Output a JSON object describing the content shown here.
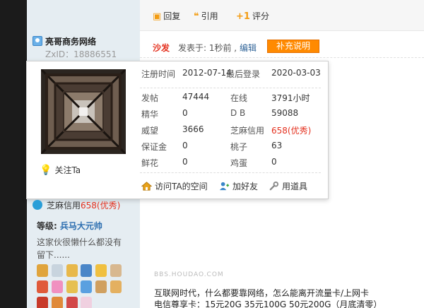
{
  "toolbar": {
    "reply_label": "回复",
    "quote_label": "引用",
    "rate_label": "评分"
  },
  "post": {
    "floor_label": "沙发",
    "posted_text": "发表于: 1秒前 ,",
    "edit_label": "编辑",
    "supplement_label": "补充说明"
  },
  "user": {
    "name": "亮哥商务网络",
    "zxid": "ZxID：18886551"
  },
  "profile_card": {
    "follow_label": "关注Ta",
    "rows": [
      {
        "label1": "注册时间",
        "value1": "2012-07-14",
        "label2": "最后登录",
        "value2": "2020-03-03"
      },
      {
        "label1": "发帖",
        "value1": "47444",
        "label2": "在线",
        "value2": "3791小时"
      },
      {
        "label1": "精华",
        "value1": "0",
        "label2": "D B",
        "value2": "59088"
      },
      {
        "label1": "威望",
        "value1": "3666",
        "label2": "芝麻信用",
        "value2": "658(优秀)"
      },
      {
        "label1": "保证金",
        "value1": "0",
        "label2": "桃子",
        "value2": "63"
      },
      {
        "label1": "鲜花",
        "value1": "0",
        "label2": "鸡蛋",
        "value2": "0"
      }
    ],
    "actions": {
      "visit_space": "访问TA的空间",
      "add_friend": "加好友",
      "use_tool": "用道具"
    }
  },
  "sidebar": {
    "zhima_label": "芝麻信用",
    "zhima_value": "658(优秀)",
    "level_label": "等级:",
    "level_value": "兵马大元帅",
    "signature": "这家伙很懒什么都没有留下......"
  },
  "content": {
    "watermark": "BBS.HOUDAO.COM",
    "line1": "互联网时代，什么都要靠网络，怎么能离开流量卡/上网卡",
    "line2": "电信尊享卡：15元20G 35元100G 50元200G（月底清零）"
  },
  "colors": {
    "accent_orange": "#ff8a00",
    "floor_red": "#e4311f",
    "link_blue": "#336699",
    "sidebar_bg": "#e5edf2"
  }
}
